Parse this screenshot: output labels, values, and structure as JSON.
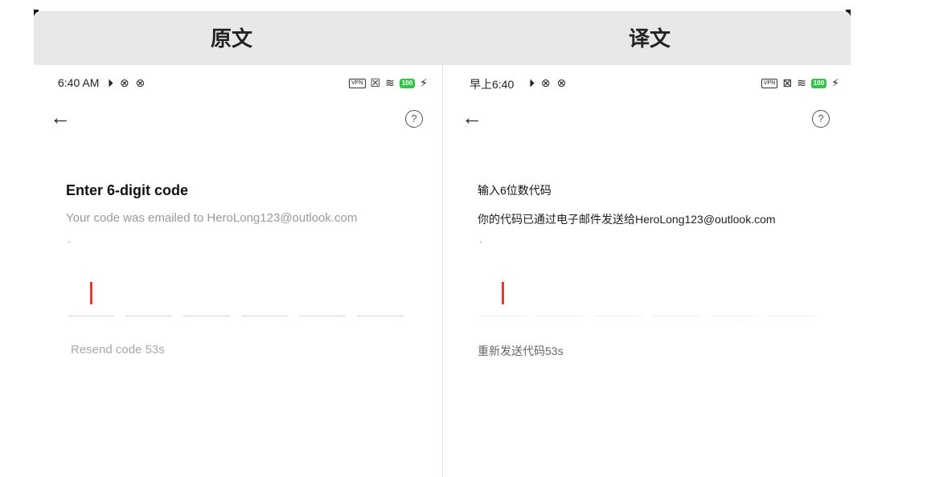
{
  "header": {
    "left_title": "原文",
    "right_title": "译文"
  },
  "left": {
    "status": {
      "time": "6:40 AM",
      "left_icons": "⏵ ⊗ ⊗",
      "vpn": "VPN",
      "x_icon": "☒",
      "wifi": "≋",
      "battery": "100",
      "bolt": "⚡"
    },
    "back_icon": "←",
    "help_icon": "?",
    "title": "Enter 6-digit code",
    "subtitle": "Your code was emailed to HeroLong123@outlook.com",
    "dot": ".",
    "resend": "Resend code  53s"
  },
  "right": {
    "status": {
      "time": "早上6:40",
      "left_icons": "⏵ ⊗ ⊗",
      "vpn": "VPN",
      "x_icon": "⊠",
      "wifi": "≋",
      "battery": "100",
      "bolt": "⚡"
    },
    "back_icon": "←",
    "help_icon": "?",
    "title": "输入6位数代码",
    "subtitle": "你的代码已通过电子邮件发送给HeroLong123@outlook.com",
    "dot": ".",
    "resend": "重新发送代码53s"
  },
  "colors": {
    "caret": "#e53935",
    "battery": "#36c34a",
    "header_bg": "#e8e8e8"
  }
}
